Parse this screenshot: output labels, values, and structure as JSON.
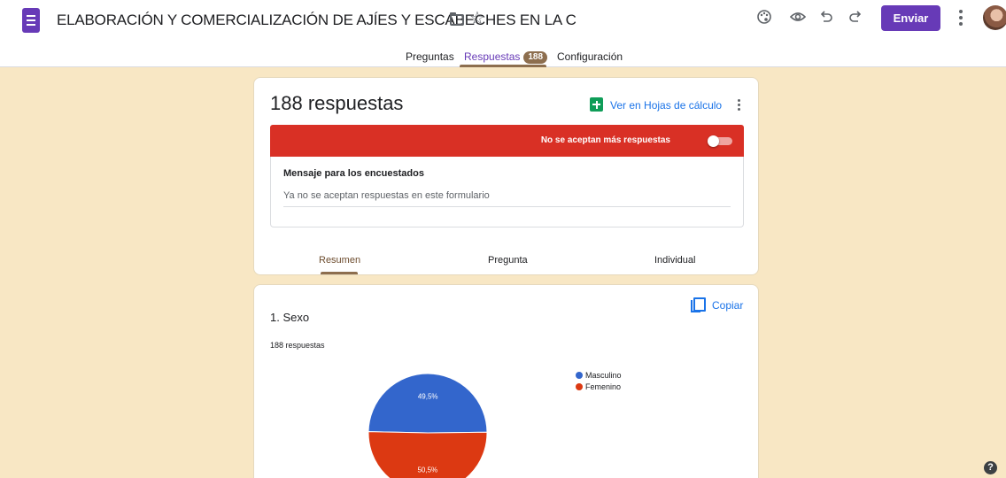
{
  "header": {
    "title": "ELABORACIÓN Y COMERCIALIZACIÓN DE AJÍES Y ESCABECHES EN LA C",
    "send_label": "Enviar",
    "icons": [
      "palette-icon",
      "preview-icon",
      "undo-icon",
      "redo-icon",
      "more-icon"
    ],
    "accent": "#673ab7"
  },
  "tabs": {
    "items": [
      {
        "label": "Preguntas"
      },
      {
        "label": "Respuestas",
        "badge": "188"
      },
      {
        "label": "Configuración"
      }
    ],
    "active": "Respuestas"
  },
  "summary": {
    "count_label": "188 respuestas",
    "sheets_link": "Ver en Hojas de cálculo",
    "closed_banner": "No se aceptan más respuestas",
    "banner_color": "#d93025",
    "accepting_toggle": false,
    "message_title": "Mensaje para los encuestados",
    "message_value": "Ya no se aceptan respuestas en este formulario",
    "subtabs": [
      "Resumen",
      "Pregunta",
      "Individual"
    ],
    "active_subtab": "Resumen"
  },
  "question": {
    "title": "1. Sexo",
    "count_label": "188 respuestas",
    "copy_label": "Copiar"
  },
  "chart_data": {
    "type": "pie",
    "categories": [
      "Masculino",
      "Femenino"
    ],
    "values": [
      49.5,
      50.5
    ],
    "labels": [
      "49,5%",
      "50,5%"
    ],
    "colors": [
      "#3366cc",
      "#dc3912"
    ],
    "legend": "right"
  },
  "help_icon": "?",
  "background": "#f8e7c4"
}
